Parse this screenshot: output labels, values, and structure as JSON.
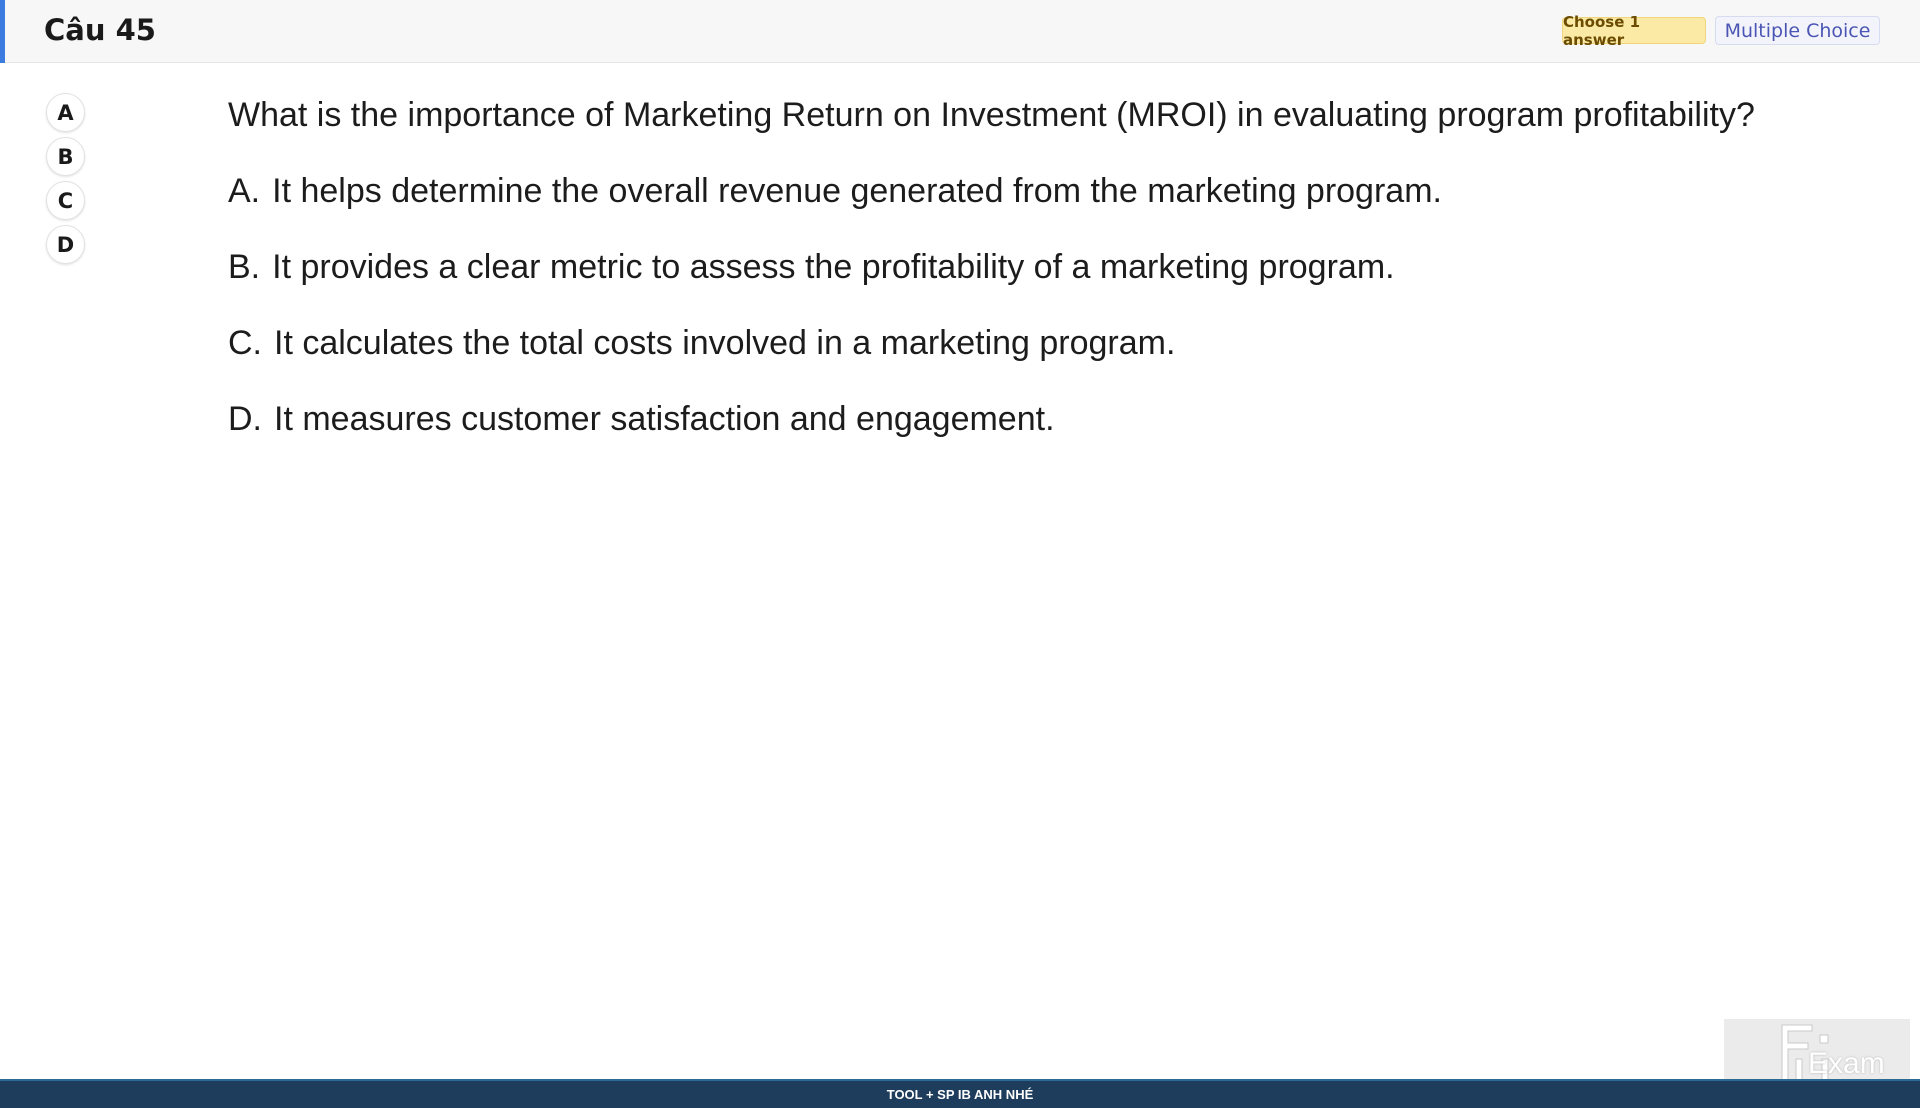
{
  "header": {
    "title": "Câu 45",
    "choose_badge": "Choose 1 answer",
    "type_badge": "Multiple Choice",
    "accent_color": "#3c7be0"
  },
  "answer_buttons": [
    {
      "label": "A"
    },
    {
      "label": "B"
    },
    {
      "label": "C"
    },
    {
      "label": "D"
    }
  ],
  "question": {
    "text": "What is the importance of Marketing Return on Investment (MROI) in evaluating program profitability?",
    "options": [
      {
        "letter": "A.",
        "text": "It helps determine the overall revenue generated from the marketing program."
      },
      {
        "letter": "B.",
        "text": "It provides a clear metric to assess the profitability of a marketing program."
      },
      {
        "letter": "C.",
        "text": "It calculates the total costs involved in a marketing program."
      },
      {
        "letter": "D.",
        "text": "It measures customer satisfaction and engagement."
      }
    ]
  },
  "watermark": {
    "text": "Exam",
    "icon": "fu-exam-logo-icon"
  },
  "footer": {
    "text": "TOOL + SP IB ANH NHÉ",
    "color": "#1e3d5c"
  }
}
